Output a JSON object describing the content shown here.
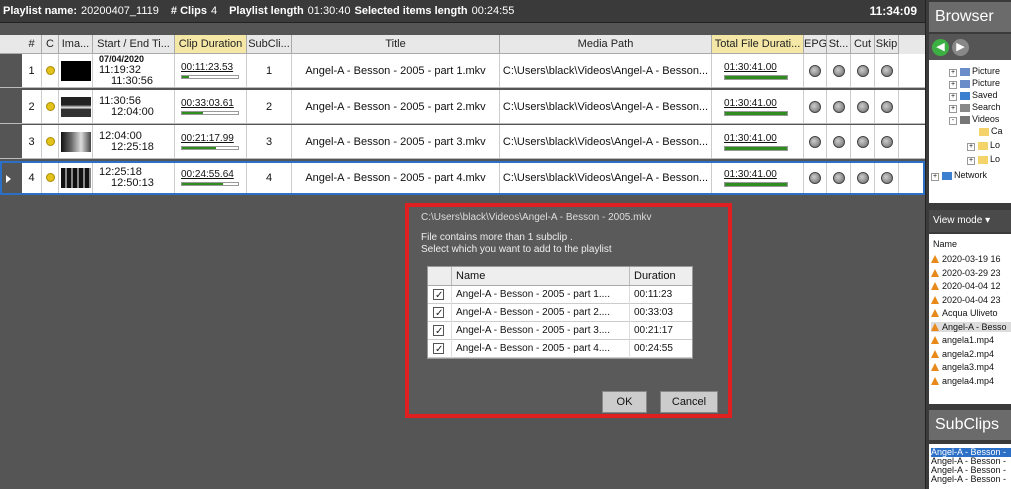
{
  "topbar": {
    "playlist_name_label": "Playlist name:",
    "playlist_name": "20200407_1119",
    "clips_label": "# Clips",
    "clips": "4",
    "length_label": "Playlist length",
    "length": "01:30:40",
    "selected_label": "Selected items length",
    "selected": "00:24:55",
    "clock": "11:34:09"
  },
  "grid": {
    "headers": [
      "#",
      "C",
      "Ima...",
      "Start / End Ti...",
      "Clip Duration",
      "SubCli...",
      "Title",
      "Media Path",
      "Total File Durati...",
      "EPG",
      "St...",
      "Cut",
      "Skip"
    ],
    "rows": [
      {
        "num": "1",
        "date": "07/04/2020",
        "start": "11:19:32",
        "end": "11:30:56",
        "duration": "00:11:23.53",
        "dur_fill": 0.12,
        "subclip": "1",
        "title": "Angel-A - Besson - 2005 - part 1.mkv",
        "path": "C:\\Users\\black\\Videos\\Angel-A - Besson...",
        "total": "01:30:41.00",
        "total_fill": 1.0
      },
      {
        "num": "2",
        "date": "",
        "start": "11:30:56",
        "end": "12:04:00",
        "duration": "00:33:03.61",
        "dur_fill": 0.37,
        "subclip": "2",
        "title": "Angel-A - Besson - 2005 - part 2.mkv",
        "path": "C:\\Users\\black\\Videos\\Angel-A - Besson...",
        "total": "01:30:41.00",
        "total_fill": 1.0
      },
      {
        "num": "3",
        "date": "",
        "start": "12:04:00",
        "end": "12:25:18",
        "duration": "00:21:17.99",
        "dur_fill": 0.6,
        "subclip": "3",
        "title": "Angel-A - Besson - 2005 - part 3.mkv",
        "path": "C:\\Users\\black\\Videos\\Angel-A - Besson...",
        "total": "01:30:41.00",
        "total_fill": 1.0
      },
      {
        "num": "4",
        "date": "",
        "start": "12:25:18",
        "end": "12:50:13",
        "duration": "00:24:55.64",
        "dur_fill": 0.73,
        "subclip": "4",
        "title": "Angel-A - Besson - 2005 - part 4.mkv",
        "path": "C:\\Users\\black\\Videos\\Angel-A - Besson...",
        "total": "01:30:41.00",
        "total_fill": 1.0
      }
    ]
  },
  "dialog": {
    "path": "C:\\Users\\black\\Videos\\Angel-A - Besson - 2005.mkv",
    "message": "File contains more than 1 subclip .\nSelect which you want to add to the playlist",
    "col_name": "Name",
    "col_duration": "Duration",
    "items": [
      {
        "name": "Angel-A - Besson - 2005 - part 1....",
        "duration": "00:11:23"
      },
      {
        "name": "Angel-A - Besson - 2005 - part 2....",
        "duration": "00:33:03"
      },
      {
        "name": "Angel-A - Besson - 2005 - part 3....",
        "duration": "00:21:17"
      },
      {
        "name": "Angel-A - Besson - 2005 - part 4....",
        "duration": "00:24:55"
      }
    ],
    "ok": "OK",
    "cancel": "Cancel"
  },
  "browser": {
    "title": "Browser",
    "tree": [
      "Picture",
      "Picture",
      "Saved",
      "Search",
      "Videos",
      "Ca",
      "Lo",
      "Lo",
      "Network"
    ],
    "view_mode": "View mode",
    "col_name": "Name",
    "files": [
      "2020-03-19 16",
      "2020-03-29 23",
      "2020-04-04 12",
      "2020-04-04 23",
      "Acqua Uliveto",
      "Angel-A - Besso",
      "angela1.mp4",
      "angela2.mp4",
      "angela3.mp4",
      "angela4.mp4"
    ]
  },
  "subclips": {
    "title": "SubClips",
    "items": [
      "Angel-A - Besson -",
      "Angel-A - Besson -",
      "Angel-A - Besson -",
      "Angel-A - Besson -"
    ]
  }
}
